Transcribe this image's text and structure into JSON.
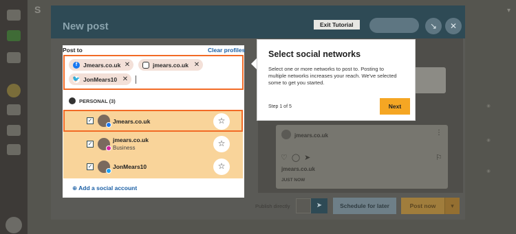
{
  "modal": {
    "title": "New post",
    "exit_tutorial": "Exit Tutorial"
  },
  "composer": {
    "post_to_label": "Post to",
    "clear_profiles": "Clear profiles",
    "selected_chips": [
      {
        "network": "facebook",
        "label": "Jmears.co.uk",
        "color": "#1877f2"
      },
      {
        "network": "instagram",
        "label": "jmears.co.uk",
        "color": "#333333"
      },
      {
        "network": "twitter",
        "label": "JonMears10",
        "color": "#1da1f2"
      }
    ],
    "group_label": "PERSONAL (3)",
    "accounts": [
      {
        "name": "Jmears.co.uk",
        "sub": "",
        "checked": true,
        "badge": "facebook"
      },
      {
        "name": "jmears.co.uk",
        "sub": "Business",
        "checked": true,
        "badge": "instagram"
      },
      {
        "name": "JonMears10",
        "sub": "",
        "checked": true,
        "badge": "twitter"
      }
    ],
    "add_social_account": "Add a social account"
  },
  "tutorial": {
    "title": "Select social networks",
    "body": "Select one or more networks to post to. Posting to multiple networks increases your reach. We've selected some to get you started.",
    "step": "Step 1 of 5",
    "next": "Next"
  },
  "preview": {
    "account_name": "jmears.co.uk",
    "account_name_2": "jmears.co.uk",
    "timestamp": "JUST NOW"
  },
  "footer": {
    "publish_directly": "Publish directly",
    "schedule_for_later": "Schedule for later",
    "post_now": "Post now"
  },
  "colors": {
    "accent_orange": "#f26a25",
    "next_button": "#f5a623",
    "link_blue": "#1a5fa5",
    "header_teal": "#2e4a55"
  }
}
